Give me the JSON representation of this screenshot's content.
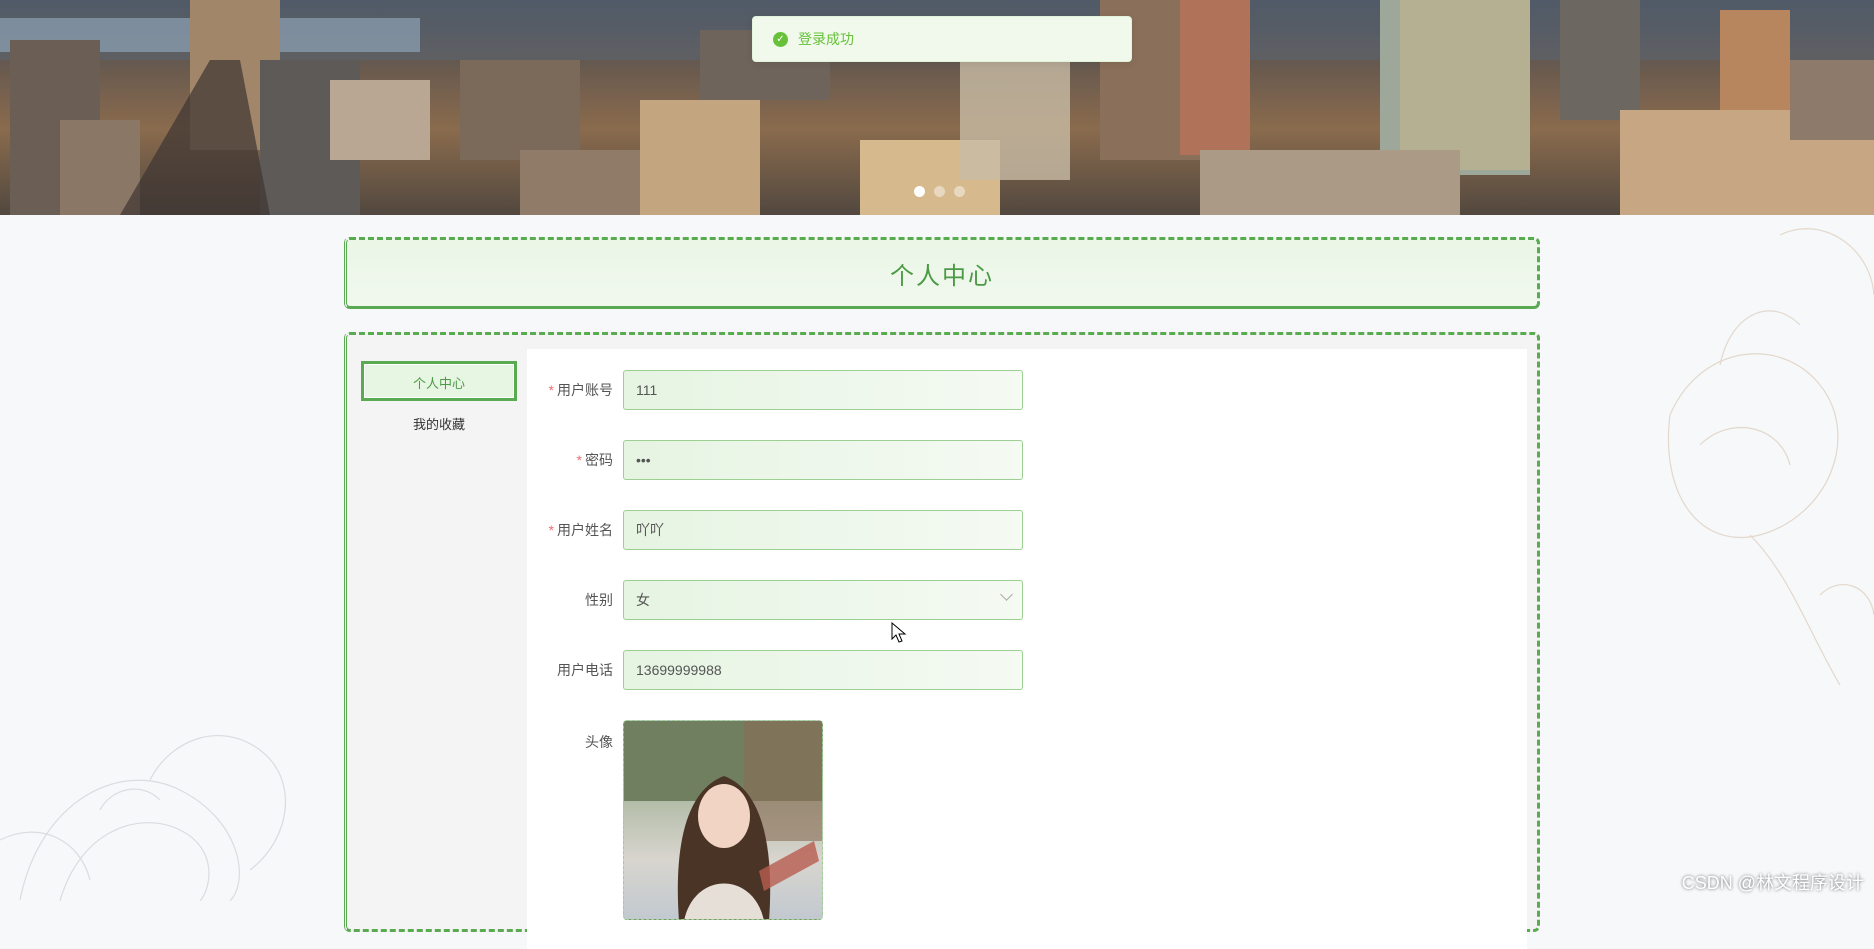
{
  "toast": {
    "message": "登录成功",
    "icon": "check-circle-icon"
  },
  "banner": {
    "slides": 3,
    "active_slide": 1
  },
  "page_title": "个人中心",
  "sidebar": {
    "items": [
      {
        "label": "个人中心",
        "active": true
      },
      {
        "label": "我的收藏",
        "active": false
      }
    ]
  },
  "form": {
    "account": {
      "label": "用户账号",
      "required": "*",
      "value": "111"
    },
    "password": {
      "label": "密码",
      "required": "*",
      "value": "111"
    },
    "name": {
      "label": "用户姓名",
      "required": "*",
      "value": "吖吖"
    },
    "gender": {
      "label": "性别",
      "value": "女"
    },
    "phone": {
      "label": "用户电话",
      "value": "13699999988"
    },
    "avatar": {
      "label": "头像"
    }
  },
  "watermark": "CSDN @林文程序设计",
  "colors": {
    "accent": "#5aaa52",
    "success": "#67c23a",
    "required": "#f56c6c"
  }
}
